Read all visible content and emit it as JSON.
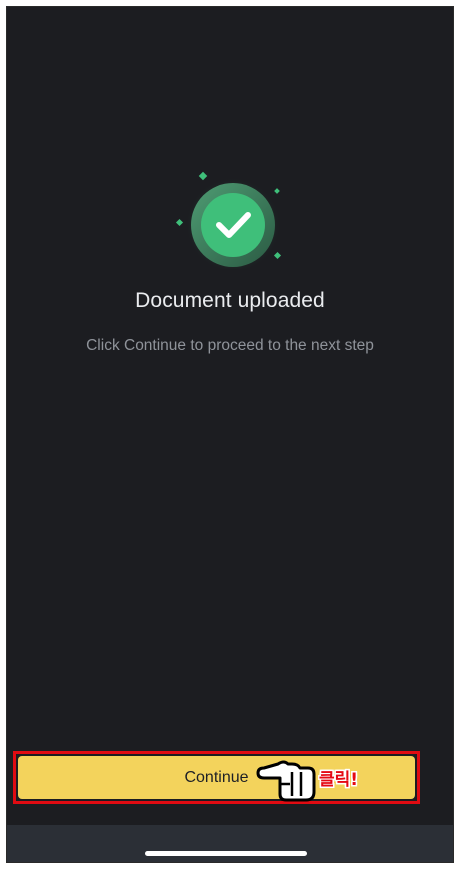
{
  "screen": {
    "title": "Document uploaded",
    "subtitle": "Click Continue to proceed to the next step"
  },
  "continue_button": {
    "label": "Continue"
  },
  "annotation": {
    "callout_text": "클릭!",
    "pointer_icon": "pointing-hand-icon"
  },
  "icons": {
    "success": "check-circle-icon"
  },
  "colors": {
    "background": "#1c1d21",
    "accent_button": "#f3d35c",
    "success_green": "#3fbf7a",
    "annotation_red": "#e00b12"
  }
}
